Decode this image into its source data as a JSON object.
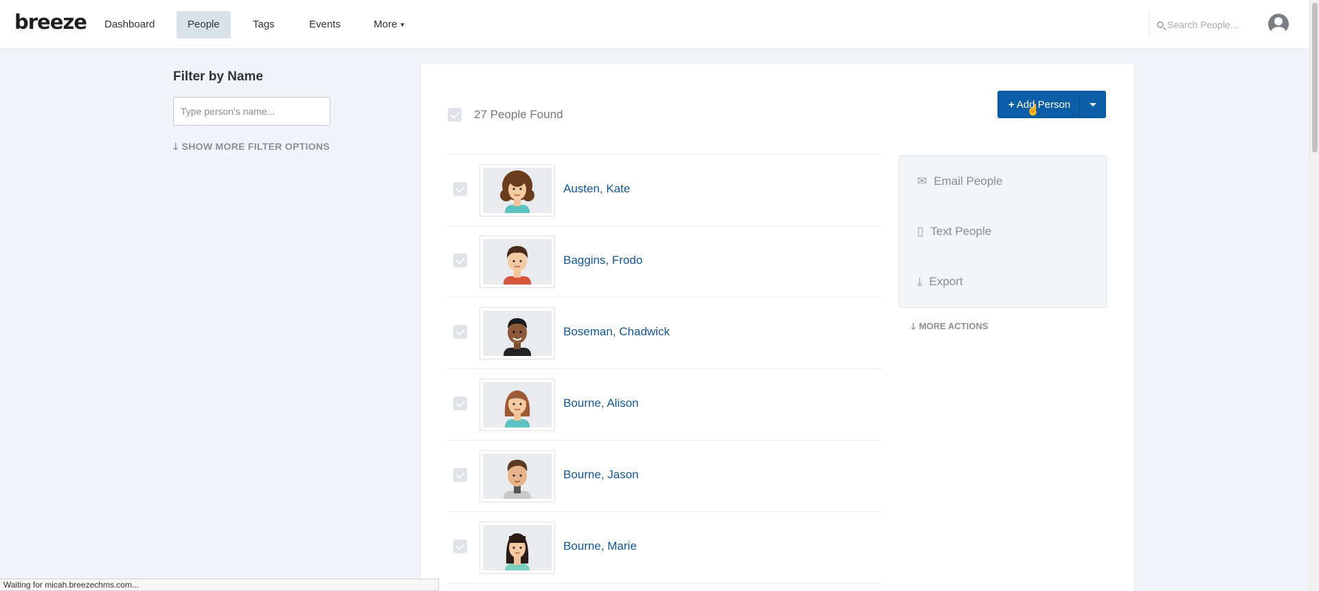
{
  "header": {
    "logo": "breeze",
    "nav": [
      {
        "label": "Dashboard",
        "active": false
      },
      {
        "label": "People",
        "active": true
      },
      {
        "label": "Tags",
        "active": false
      },
      {
        "label": "Events",
        "active": false
      },
      {
        "label": "More",
        "active": false
      }
    ],
    "search_placeholder": "Search People..."
  },
  "filter": {
    "title": "Filter by Name",
    "input_placeholder": "Type person's name...",
    "more_options": "SHOW MORE FILTER OPTIONS"
  },
  "main": {
    "found_count": "27 People Found",
    "add_button": "Add Person",
    "people": [
      {
        "name": "Austen, Kate"
      },
      {
        "name": "Baggins, Frodo"
      },
      {
        "name": "Boseman, Chadwick"
      },
      {
        "name": "Bourne, Alison"
      },
      {
        "name": "Bourne, Jason"
      },
      {
        "name": "Bourne, Marie"
      }
    ]
  },
  "actions": {
    "email": "Email People",
    "text": "Text People",
    "export": "Export",
    "more": "MORE ACTIONS"
  },
  "status_bar": "Waiting for micah.breezechms.com...",
  "colors": {
    "primary": "#0b5da6",
    "link": "#115795",
    "background": "#f1f5f9"
  }
}
